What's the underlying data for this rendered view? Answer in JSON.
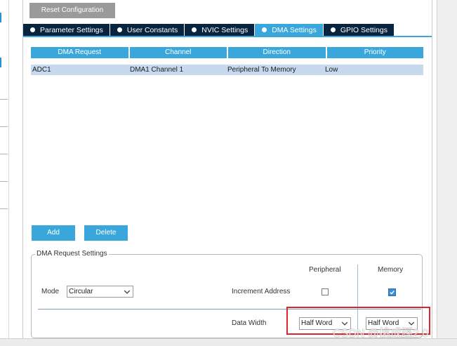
{
  "toolbar": {
    "reset_label": "Reset Configuration"
  },
  "tabs": [
    {
      "label": "Parameter Settings",
      "active": false
    },
    {
      "label": "User Constants",
      "active": false
    },
    {
      "label": "NVIC Settings",
      "active": false
    },
    {
      "label": "DMA Settings",
      "active": true
    },
    {
      "label": "GPIO Settings",
      "active": false
    }
  ],
  "table": {
    "headers": [
      "DMA Request",
      "Channel",
      "Direction",
      "Priority"
    ],
    "rows": [
      [
        "ADC1",
        "DMA1 Channel 1",
        "Peripheral To Memory",
        "Low"
      ]
    ]
  },
  "actions": {
    "add_label": "Add",
    "delete_label": "Delete"
  },
  "settings": {
    "title": "DMA Request Settings",
    "col_peripheral": "Peripheral",
    "col_memory": "Memory",
    "mode_label": "Mode",
    "mode_value": "Circular",
    "increment_label": "Increment Address",
    "increment_peripheral": false,
    "increment_memory": true,
    "data_width_label": "Data Width",
    "data_width_peripheral": "Half Word",
    "data_width_memory": "Half Word"
  },
  "watermark": "CSDN @桃成蹊2.0",
  "colors": {
    "accent": "#39a7db",
    "tab_dark": "#09243f",
    "highlight": "#d9252b"
  }
}
